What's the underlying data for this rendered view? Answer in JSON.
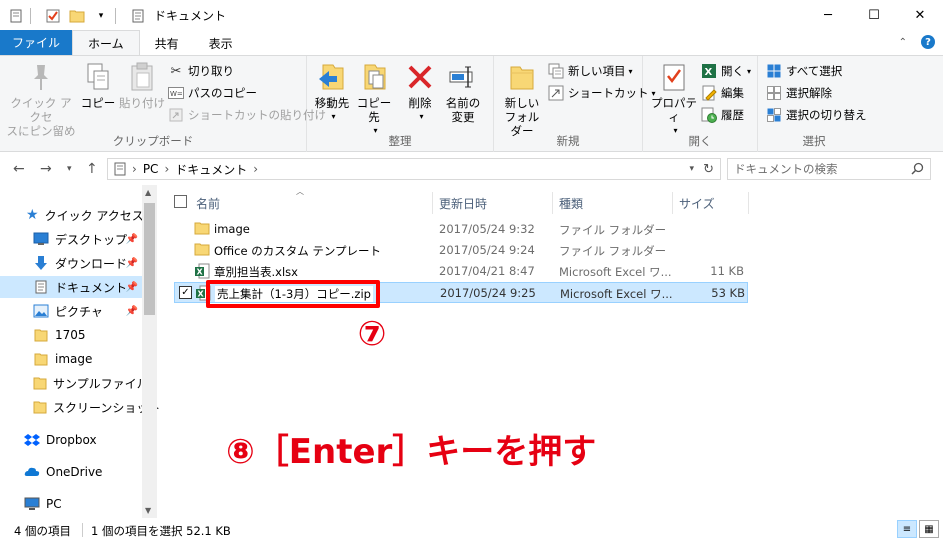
{
  "window": {
    "title": "ドキュメント",
    "minimize": "─",
    "maximize": "☐",
    "close": "✕"
  },
  "tabs": {
    "file": "ファイル",
    "home": "ホーム",
    "share": "共有",
    "view": "表示"
  },
  "ribbon": {
    "clipboard": {
      "label": "クリップボード",
      "pin": "クイック アクセ\nスにピン留め",
      "copy": "コピー",
      "paste": "貼り付け",
      "cut": "切り取り",
      "copy_path": "パスのコピー",
      "paste_shortcut": "ショートカットの貼り付け"
    },
    "organize": {
      "label": "整理",
      "move_to": "移動先",
      "copy_to": "コピー先",
      "delete": "削除",
      "rename": "名前の\n変更"
    },
    "new": {
      "label": "新規",
      "new_folder": "新しい\nフォルダー",
      "new_item": "新しい項目",
      "easy_access": "ショートカット"
    },
    "open": {
      "label": "開く",
      "properties": "プロパティ",
      "open": "開く",
      "edit": "編集",
      "history": "履歴"
    },
    "select": {
      "label": "選択",
      "select_all": "すべて選択",
      "select_none": "選択解除",
      "invert": "選択の切り替え"
    }
  },
  "address": {
    "path": [
      "PC",
      "ドキュメント"
    ],
    "search_placeholder": "ドキュメントの検索"
  },
  "navpane": {
    "items": [
      {
        "label": "クイック アクセス",
        "icon": "star-icon",
        "pinned": false
      },
      {
        "label": "デスクトップ",
        "icon": "desktop-icon",
        "pinned": true
      },
      {
        "label": "ダウンロード",
        "icon": "download-icon",
        "pinned": true
      },
      {
        "label": "ドキュメント",
        "icon": "document-icon",
        "pinned": true
      },
      {
        "label": "ピクチャ",
        "icon": "picture-icon",
        "pinned": true
      },
      {
        "label": "1705",
        "icon": "folder-icon",
        "pinned": false
      },
      {
        "label": "image",
        "icon": "folder-icon",
        "pinned": false
      },
      {
        "label": "サンプルファイル",
        "icon": "folder-icon",
        "pinned": false
      },
      {
        "label": "スクリーンショット",
        "icon": "folder-icon",
        "pinned": false
      },
      {
        "label": "Dropbox",
        "icon": "dropbox-icon",
        "pinned": false
      },
      {
        "label": "OneDrive",
        "icon": "onedrive-icon",
        "pinned": false
      },
      {
        "label": "PC",
        "icon": "pc-icon",
        "pinned": false
      }
    ]
  },
  "filelist": {
    "columns": [
      "名前",
      "更新日時",
      "種類",
      "サイズ"
    ],
    "rows": [
      {
        "name": "image",
        "date": "2017/05/24 9:32",
        "type": "ファイル フォルダー",
        "size": "",
        "icon": "folder-icon"
      },
      {
        "name": "Office のカスタム テンプレート",
        "date": "2017/05/24 9:24",
        "type": "ファイル フォルダー",
        "size": "",
        "icon": "folder-icon"
      },
      {
        "name": "章別担当表.xlsx",
        "date": "2017/04/21 8:47",
        "type": "Microsoft Excel ワ...",
        "size": "11 KB",
        "icon": "excel-icon"
      },
      {
        "name": "売上集計（1-3月）コピー.zip",
        "date": "2017/05/24 9:25",
        "type": "Microsoft Excel ワ...",
        "size": "53 KB",
        "icon": "excel-icon"
      }
    ]
  },
  "annotations": {
    "step7": "⑦",
    "step8": "⑧［Enter］キーを押す"
  },
  "status": {
    "count": "4 個の項目",
    "selected": "1 個の項目を選択  52.1 KB"
  },
  "colors": {
    "accent": "#1979ca",
    "selection": "#cce8ff",
    "annotation": "#e60012"
  }
}
